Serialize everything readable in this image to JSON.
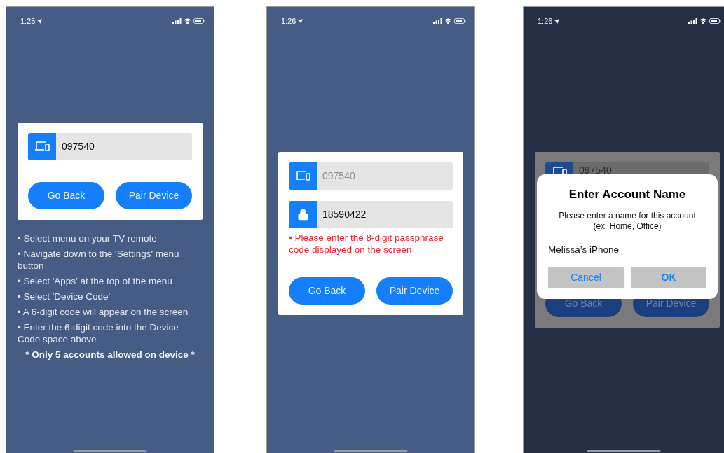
{
  "screens": [
    {
      "time": "1:25",
      "dimmed": false,
      "card": {
        "fields": [
          {
            "kind": "device",
            "value": "097540",
            "disabled": false
          }
        ],
        "buttons": [
          {
            "label": "Go Back"
          },
          {
            "label": "Pair Device"
          }
        ]
      },
      "instructions": [
        "• Select menu on your TV remote",
        "• Navigate down to the 'Settings' menu button",
        "• Select 'Apps' at the top of the menu",
        "• Select 'Device Code'",
        "• A 6-digit code will appear on the screen",
        "• Enter the 6-digit code into the Device Code space above"
      ],
      "note": "* Only 5 accounts allowed on device *"
    },
    {
      "time": "1:26",
      "dimmed": false,
      "card": {
        "fields": [
          {
            "kind": "device",
            "value": "097540",
            "disabled": true
          },
          {
            "kind": "lock",
            "value": "18590422",
            "disabled": false
          }
        ],
        "error": "• Please enter the 8-digit passphrase code displayed on the screen",
        "buttons": [
          {
            "label": "Go Back"
          },
          {
            "label": "Pair Device"
          }
        ]
      }
    },
    {
      "time": "1:26",
      "dimmed": true,
      "card": {
        "fields": [
          {
            "kind": "device",
            "value": "097540",
            "disabled": true
          }
        ],
        "buttons": [
          {
            "label": "Go Back"
          },
          {
            "label": "Pair Device"
          }
        ]
      },
      "dialog": {
        "title": "Enter Account Name",
        "message": "Please enter a name for this account (ex. Home, Office)",
        "value": "Melissa’s iPhone",
        "buttons": [
          {
            "label": "Cancel",
            "bold": false
          },
          {
            "label": "OK",
            "bold": true
          }
        ]
      }
    }
  ]
}
